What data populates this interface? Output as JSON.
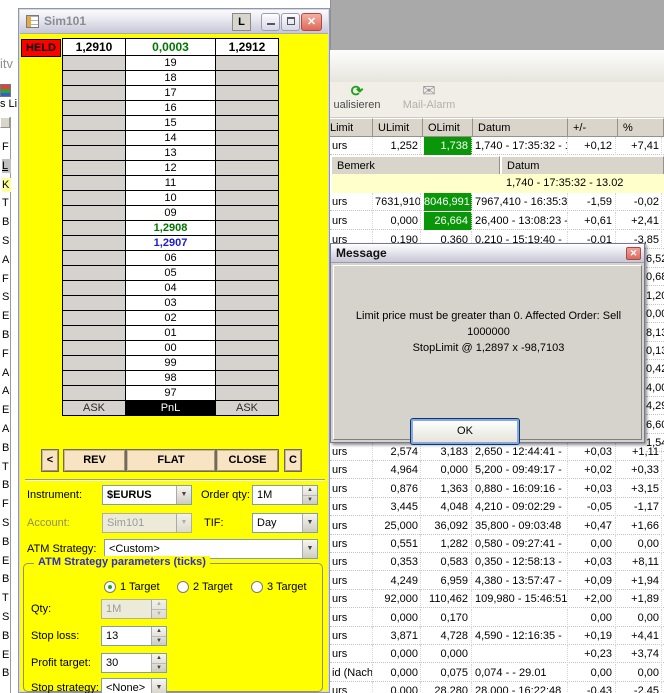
{
  "sim_window": {
    "title": "Sim101",
    "link_button_label": "L",
    "held_label": "HELD",
    "quote": {
      "bid": "1,2910",
      "spread": "0,0003",
      "ask": "1,2912"
    },
    "ladder": {
      "rows": [
        {
          "label": "19"
        },
        {
          "label": "18"
        },
        {
          "label": "17"
        },
        {
          "label": "16"
        },
        {
          "label": "15"
        },
        {
          "label": "14"
        },
        {
          "label": "13"
        },
        {
          "label": "12"
        },
        {
          "label": "11"
        },
        {
          "label": "10"
        },
        {
          "label": "09"
        },
        {
          "label": "1,2908",
          "style": "green"
        },
        {
          "label": "1,2907",
          "style": "blue"
        },
        {
          "label": "06"
        },
        {
          "label": "05"
        },
        {
          "label": "04"
        },
        {
          "label": "03"
        },
        {
          "label": "02"
        },
        {
          "label": "01"
        },
        {
          "label": "00"
        },
        {
          "label": "99"
        },
        {
          "label": "98"
        },
        {
          "label": "97"
        }
      ],
      "footer": {
        "left": "ASK",
        "center": "PnL",
        "right": "ASK"
      }
    },
    "action_buttons": {
      "back": "<",
      "rev": "REV",
      "flat": "FLAT",
      "close": "CLOSE",
      "c": "C"
    },
    "form": {
      "instrument_label": "Instrument:",
      "instrument_value": "$EURUS",
      "order_qty_label": "Order qty:",
      "order_qty_value": "1M",
      "account_label": "Account:",
      "account_value": "Sim101",
      "tif_label": "TIF:",
      "tif_value": "Day",
      "atm_label": "ATM Strategy:",
      "atm_value": "<Custom>"
    },
    "atm_group": {
      "title": "ATM Strategy parameters (ticks)",
      "radios": [
        {
          "label": "1 Target",
          "selected": true
        },
        {
          "label": "2 Target",
          "selected": false
        },
        {
          "label": "3 Target",
          "selected": false
        }
      ],
      "qty_label": "Qty:",
      "qty_value": "1M",
      "stop_loss_label": "Stop loss:",
      "stop_loss_value": "13",
      "profit_target_label": "Profit target:",
      "profit_target_value": "30",
      "stop_strategy_label": "Stop strategy:",
      "stop_strategy_value": "<None>"
    }
  },
  "dialog": {
    "title": "Message",
    "line1": "Limit price must be greater than 0. Affected Order: Sell 1000000",
    "line2": "StopLimit @ 1,2897 x -98,7103",
    "ok_label": "OK"
  },
  "background": {
    "toolbar": {
      "refresh_label": "ualisieren",
      "mail_label": "Mail-Alarm"
    },
    "left_strip": {
      "title_fragment": "itv",
      "list_fragment": "s Li",
      "row_letters": [
        {
          "ch": "F"
        },
        {
          "ch": "L",
          "hl": "selected"
        },
        {
          "ch": "K",
          "hl": "yellow"
        },
        {
          "ch": "T"
        },
        {
          "ch": "B"
        },
        {
          "ch": "S"
        },
        {
          "ch": "A"
        },
        {
          "ch": "F"
        },
        {
          "ch": "S"
        },
        {
          "ch": "E"
        },
        {
          "ch": "B"
        },
        {
          "ch": "F"
        },
        {
          "ch": "A"
        },
        {
          "ch": "A"
        },
        {
          "ch": "E"
        },
        {
          "ch": "A"
        },
        {
          "ch": "B"
        },
        {
          "ch": "T"
        },
        {
          "ch": "B"
        },
        {
          "ch": "F"
        },
        {
          "ch": "S"
        },
        {
          "ch": "B"
        },
        {
          "ch": "E"
        },
        {
          "ch": "B"
        },
        {
          "ch": "T"
        },
        {
          "ch": "S"
        },
        {
          "ch": "B"
        },
        {
          "ch": "E"
        },
        {
          "ch": "B"
        }
      ]
    },
    "table": {
      "headers": [
        "Limit",
        "ULimit",
        "OLimit",
        "Datum",
        "+/-",
        "%"
      ],
      "subheaders": [
        "Bemerk",
        "Datum"
      ],
      "highlight_row_datum": "1,740  - 17:35:32 - 13.02",
      "rows_top": [
        {
          "name": "urs",
          "ulimit": "1,252",
          "olimit": "1,738",
          "green": true,
          "datum": "1,740  - 17:35:32 - 1",
          "chg": "+0,12",
          "pct": "+7,41"
        },
        {
          "name": "urs",
          "ulimit": "7631,910",
          "olimit": "8046,991",
          "green": true,
          "datum": "7967,410  - 16:35:3",
          "chg": "-1,59",
          "pct": "-0,02"
        },
        {
          "name": "urs",
          "ulimit": "0,000",
          "olimit": "26,664",
          "green": true,
          "datum": "26,400  - 13:08:23 -",
          "chg": "+0,61",
          "pct": "+2,41"
        },
        {
          "name": "urs",
          "ulimit": "0,190",
          "olimit": "0,360",
          "green": false,
          "datum": "0,210  - 15:19:40 - ",
          "chg": "-0,01",
          "pct": "-3,85"
        }
      ],
      "fragments": [
        "6,52",
        "0,68",
        "1,20",
        "0,00",
        "8,13",
        "0,13",
        "0,42",
        "4,00",
        "4,29",
        "6,60",
        "1,54"
      ],
      "rows_bottom": [
        {
          "name": "urs",
          "ulimit": "2,574",
          "olimit": "3,183",
          "green": false,
          "datum": "2,650  - 12:44:41 - ",
          "chg": "+0,03",
          "pct": "+1,11"
        },
        {
          "name": "urs",
          "ulimit": "4,964",
          "olimit": "0,000",
          "green": false,
          "datum": "5,200  - 09:49:17 - ",
          "chg": "+0,02",
          "pct": "+0,33"
        },
        {
          "name": "urs",
          "ulimit": "0,876",
          "olimit": "1,363",
          "green": false,
          "datum": "0,880  - 16:09:16 - ",
          "chg": "+0,03",
          "pct": "+3,15"
        },
        {
          "name": "urs",
          "ulimit": "3,445",
          "olimit": "4,048",
          "green": false,
          "datum": "4,210  - 09:02:29 - ",
          "chg": "-0,05",
          "pct": "-1,17"
        },
        {
          "name": "urs",
          "ulimit": "25,000",
          "olimit": "36,092",
          "green": false,
          "datum": "35,800  - 09:03:48 ",
          "chg": "+0,47",
          "pct": "+1,66"
        },
        {
          "name": "urs",
          "ulimit": "0,551",
          "olimit": "1,282",
          "green": false,
          "datum": "0,580  - 09:27:41 - ",
          "chg": "0,00",
          "pct": "0,00"
        },
        {
          "name": "urs",
          "ulimit": "0,353",
          "olimit": "0,583",
          "green": false,
          "datum": "0,350  - 12:58:13 - ",
          "chg": "+0,03",
          "pct": "+8,11"
        },
        {
          "name": "urs",
          "ulimit": "4,249",
          "olimit": "6,959",
          "green": false,
          "datum": "4,380  - 13:57:47 - ",
          "chg": "+0,09",
          "pct": "+1,94"
        },
        {
          "name": "urs",
          "ulimit": "92,000",
          "olimit": "110,462",
          "green": false,
          "datum": "109,980  - 15:46:51",
          "chg": "+2,00",
          "pct": "+1,89"
        },
        {
          "name": "urs",
          "ulimit": "0,000",
          "olimit": "0,170",
          "green": false,
          "datum": "",
          "chg": "0,00",
          "pct": "0,00"
        },
        {
          "name": "urs",
          "ulimit": "3,871",
          "olimit": "4,728",
          "green": false,
          "datum": "4,590  - 12:16:35 - ",
          "chg": "+0,19",
          "pct": "+4,41"
        },
        {
          "name": "urs",
          "ulimit": "0,000",
          "olimit": "0,000",
          "green": false,
          "datum": "",
          "chg": "+0,23",
          "pct": "+3,74"
        },
        {
          "name": "id (Nach",
          "ulimit": "0,000",
          "olimit": "0,075",
          "green": false,
          "datum": "0,074  - - 29.01",
          "chg": "0,00",
          "pct": "0,00"
        },
        {
          "name": "urs",
          "ulimit": "0,000",
          "olimit": "28,280",
          "green": false,
          "datum": "28,000  - 16:22:48 ",
          "chg": "-0,43",
          "pct": "-2,45"
        }
      ]
    },
    "colors": {
      "panel_yellow": "#ffff00",
      "held_red": "#ff0000",
      "highlight_green_cell": "#099609",
      "highlight_row_yellow": "#ffffcc",
      "price_up_green": "#007800",
      "price_blue": "#1a1ad6"
    }
  }
}
